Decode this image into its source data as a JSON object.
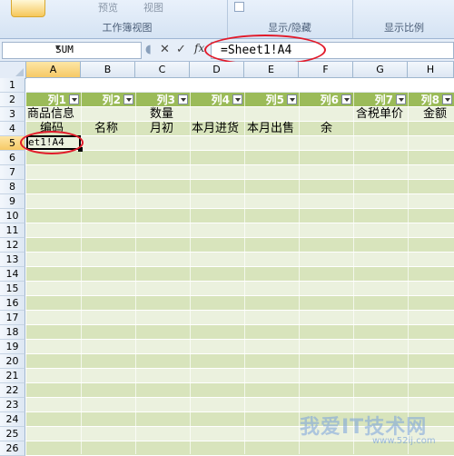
{
  "ribbon": {
    "buttons": [
      "预览",
      "视图"
    ],
    "groups": [
      "工作簿视图",
      "显示/隐藏",
      "显示比例"
    ]
  },
  "formula_bar": {
    "name_box": "SUM",
    "formula": "=Sheet1!A4",
    "buttons": [
      "cancel",
      "enter",
      "fx"
    ]
  },
  "columns": [
    "A",
    "B",
    "C",
    "D",
    "E",
    "F",
    "G",
    "H"
  ],
  "rows": [
    "1",
    "2",
    "3",
    "4",
    "5",
    "6",
    "7",
    "8",
    "9",
    "10",
    "11",
    "12",
    "13",
    "14",
    "15",
    "16",
    "17",
    "18",
    "19",
    "20",
    "21",
    "22",
    "23",
    "24",
    "25",
    "26"
  ],
  "table_headers": [
    "列1",
    "列2",
    "列3",
    "列4",
    "列5",
    "列6",
    "列7",
    "列8"
  ],
  "cells": {
    "a3": "商品信息",
    "a4": "编码",
    "b4": "名称",
    "c3": "数量",
    "c4": "月初",
    "d4": "本月进货",
    "e4": "本月出售",
    "f4": "余",
    "g3": "含税单价",
    "h3": "金额"
  },
  "active_cell_edit": "et1!A4",
  "watermark": {
    "text": "我爱IT技术网",
    "url": "www.52ij.com"
  },
  "colors": {
    "header_band": "#9bbb59",
    "band_light": "#ebf1de",
    "band_dark": "#d8e4bc",
    "highlight_oval": "#e21a2a"
  }
}
